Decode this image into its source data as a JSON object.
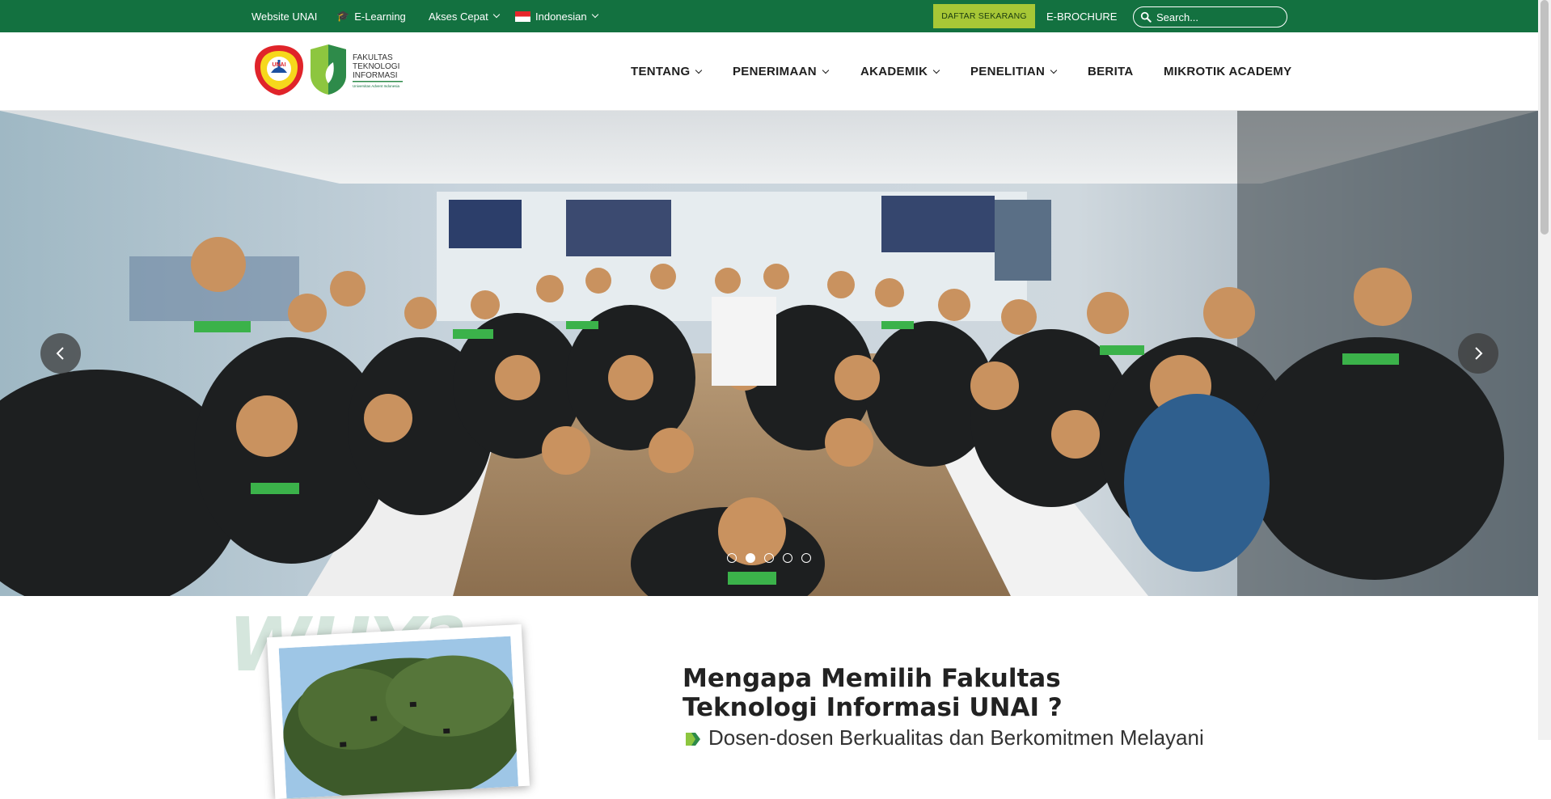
{
  "topbar": {
    "links": {
      "website_unai": "Website UNAI",
      "elearning": "E-Learning",
      "akses_cepat": "Akses Cepat",
      "language": "Indonesian"
    },
    "daftar_button": "DAFTAR SEKARANG",
    "ebrochure": "E-BROCHURE",
    "search_placeholder": "Search..."
  },
  "logos": {
    "unai_seal_text": "UNAI",
    "fti_text": [
      "FAKULTAS",
      "TEKNOLOGI",
      "INFORMASI"
    ],
    "fti_sub": "Universitas Advent Indonesia"
  },
  "nav": {
    "items": [
      {
        "label": "TENTANG",
        "dropdown": true
      },
      {
        "label": "PENERIMAAN",
        "dropdown": true
      },
      {
        "label": "AKADEMIK",
        "dropdown": true
      },
      {
        "label": "PENELITIAN",
        "dropdown": true
      },
      {
        "label": "BERITA",
        "dropdown": false
      },
      {
        "label": "MIKROTIK ACADEMY",
        "dropdown": false
      }
    ]
  },
  "hero": {
    "slide_count": 5,
    "active_slide": 2,
    "icons": {
      "prev": "chevron-left-icon",
      "next": "chevron-right-icon"
    }
  },
  "why_section": {
    "why_word": "WHY?",
    "title": "Mengapa Memilih Fakultas Teknologi Informasi UNAI ?",
    "bullets": [
      "Dosen-dosen Berkualitas dan Berkomitmen Melayani"
    ]
  },
  "colors": {
    "topbar_bg": "#137140",
    "daftar_bg": "#a7c736",
    "brand_green": "#137140",
    "accent_green": "#8dc63f"
  }
}
